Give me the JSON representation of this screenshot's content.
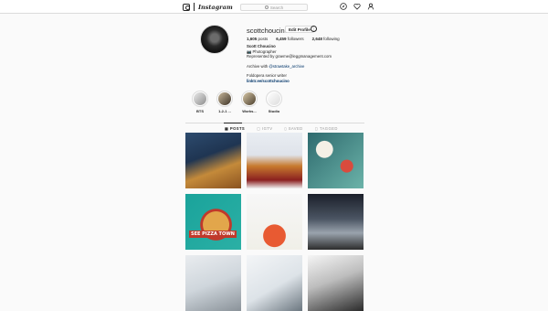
{
  "topbar": {
    "wordmark": "Instagram",
    "search_placeholder": "Search"
  },
  "profile": {
    "username": "scottchoucino",
    "edit_label": "Edit Profile",
    "stats": [
      {
        "value": "1,605",
        "label": "posts"
      },
      {
        "value": "6,459",
        "label": "followers"
      },
      {
        "value": "2,648",
        "label": "following"
      }
    ],
    "bio": {
      "name": "Scott Choucino",
      "line1": "📷 Photographer",
      "line2": "Represented by graeme@leggmanagement.com",
      "archive_prefix": "Archive with",
      "archive_handle": "@strawtake_archive",
      "line4": "Foldopera senior writer",
      "link": "linktr.ee/scottchoucino"
    }
  },
  "highlights": [
    {
      "label": "BTS",
      "color": "#cfcfcf"
    },
    {
      "label": "1-2-1 ...",
      "color": "#7a6b5a"
    },
    {
      "label": "Works...",
      "color": "#9a8b70"
    },
    {
      "label": "Studio",
      "color": "#e8e8e8"
    }
  ],
  "tabs": [
    "POSTS",
    "IGTV",
    "SAVED",
    "TAGGED"
  ],
  "posts": [
    {
      "name": "pancakes-post",
      "bg": "linear-gradient(160deg,#2d4b6e 0%,#1f3552 40%,#c48a3a 65%,#8a5220 100%)"
    },
    {
      "name": "churros-post",
      "bg": "linear-gradient(180deg,#e9edf2 0%,#dfe3ea 40%,#c77a2e 60%,#8b2020 85%,#f0f0f0 100%)"
    },
    {
      "name": "table-spread-post",
      "bg": "radial-gradient(circle at 30% 30%,#f4f0e6 0 15%,transparent 16%),radial-gradient(circle at 70% 60%,#d94b3d 0 12%,transparent 13%),linear-gradient(135deg,#2e6a6e,#6bb3a9)"
    },
    {
      "name": "pizza-post",
      "bg": "radial-gradient(circle at 55% 55%,#e2a64b 0 30%,#c0392b 31% 36%,transparent 37%),linear-gradient(135deg,#1aa39b,#2bb0a5)",
      "text": "SEE PIZZA  TOWN"
    },
    {
      "name": "cocktail-post",
      "bg": "radial-gradient(circle at 50% 75%,#e85a32 0 22%,transparent 23%),linear-gradient(180deg,#f7f7f7 0%,#f0efe8 100%)"
    },
    {
      "name": "workshop-post",
      "bg": "linear-gradient(180deg,#1b1f2a 0%,#4b5563 45%,#9aa3ad 70%,#2c2c2c 100%)"
    },
    {
      "name": "studio-room-post",
      "bg": "linear-gradient(160deg,#e9ecef 0%,#cfd6dc 50%,#8a9299 100%)"
    },
    {
      "name": "studio-lights-post",
      "bg": "linear-gradient(150deg,#f3f5f7 0%,#dde3e8 55%,#6c7780 100%)"
    },
    {
      "name": "bw-studio-post",
      "bg": "linear-gradient(160deg,#f5f5f5 0%,#bdbdbd 45%,#2b2b2b 100%)"
    }
  ]
}
